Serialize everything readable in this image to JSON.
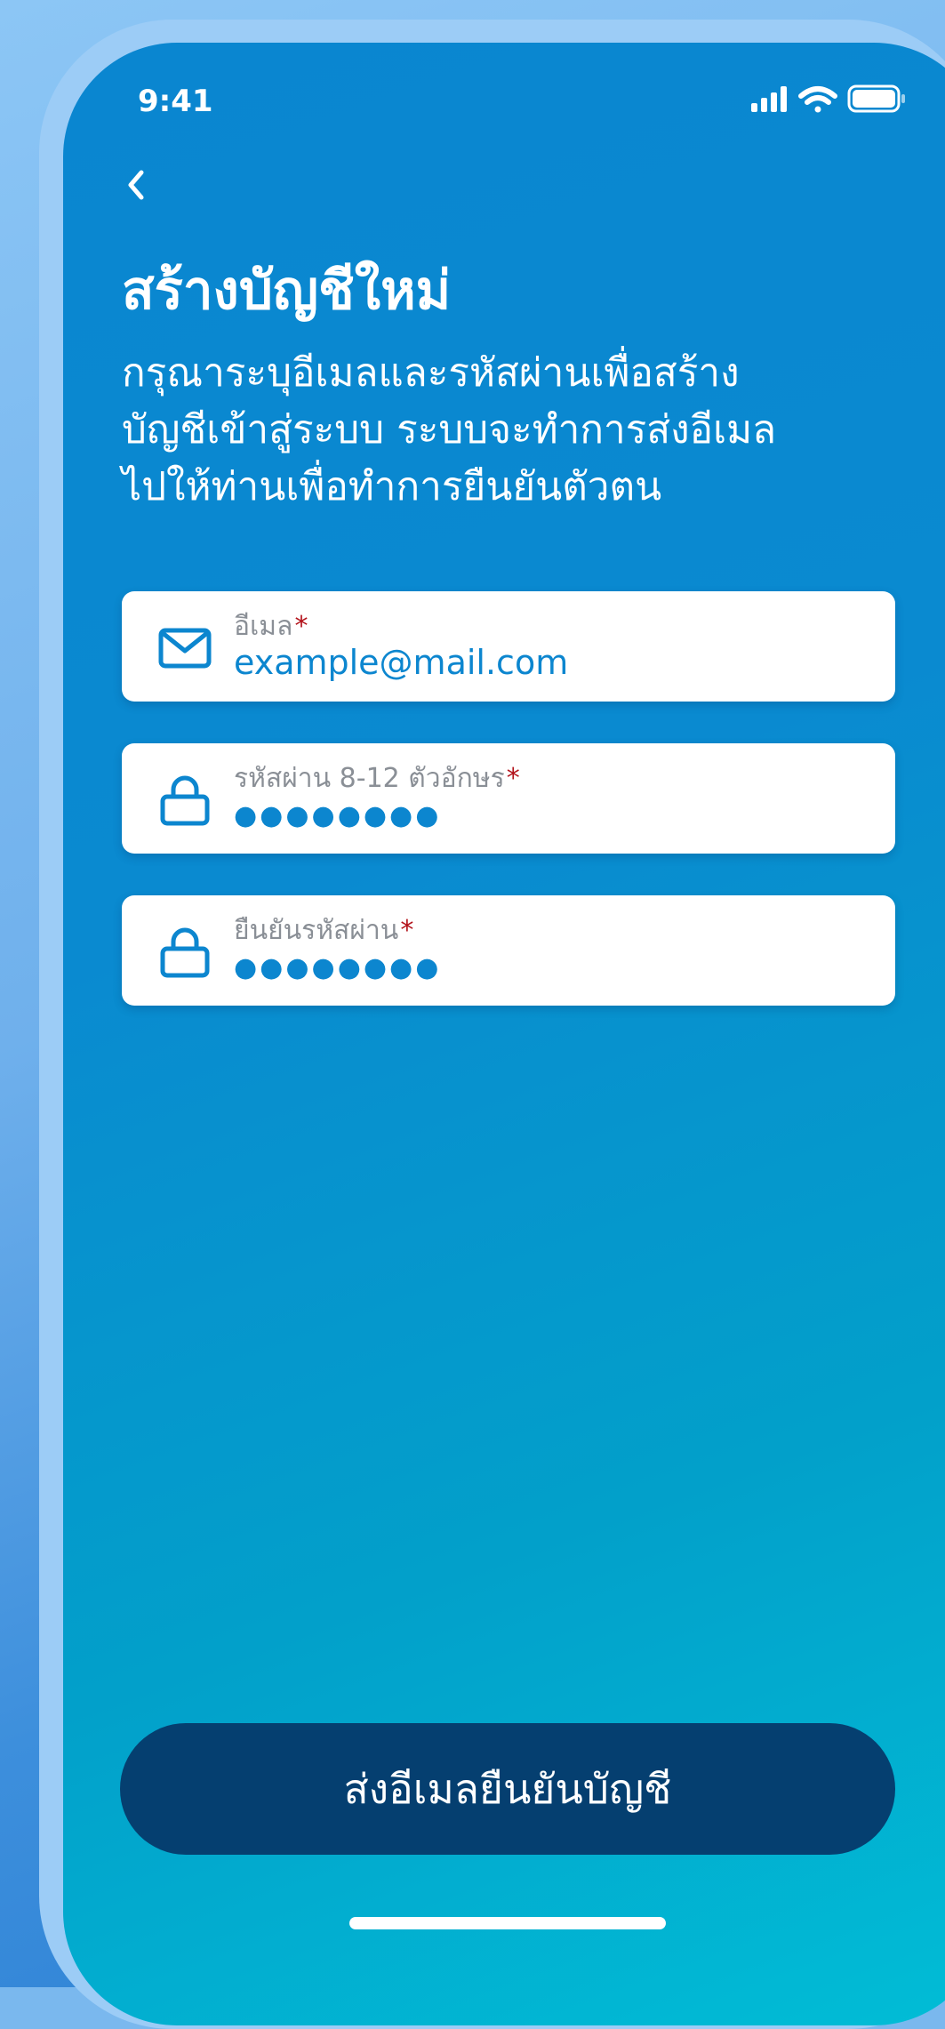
{
  "status_bar": {
    "time": "9:41",
    "icons": [
      "cellular-signal-icon",
      "wifi-icon",
      "battery-icon"
    ]
  },
  "header": {
    "back_icon": "chevron-left-icon",
    "title": "สร้างบัญชีใหม่",
    "subtitle_lines": [
      "กรุณาระบุอีเมลและรหัสผ่านเพื่อสร้าง",
      "บัญชีเข้าสู่ระบบ ระบบจะทำการส่งอีเมล",
      "ไปให้ท่านเพื่อทำการยืนยันตัวตน"
    ]
  },
  "form": {
    "email": {
      "icon": "envelope-icon",
      "label": "อีเมล",
      "required_mark": "*",
      "value": "example@mail.com"
    },
    "password": {
      "icon": "lock-icon",
      "label": "รหัสผ่าน 8-12 ตัวอักษร",
      "required_mark": "*",
      "masked_value": "●●●●●●●●"
    },
    "confirm_password": {
      "icon": "lock-icon",
      "label": "ยืนยันรหัสผ่าน",
      "required_mark": "*",
      "masked_value": "●●●●●●●●"
    }
  },
  "actions": {
    "submit_label": "ส่งอีเมลยืนยันบัญชี"
  },
  "colors": {
    "accent": "#0c86cf",
    "button": "#053f70",
    "required": "#b3131b",
    "background_start": "#0a86d0",
    "background_end": "#01bdd6"
  }
}
